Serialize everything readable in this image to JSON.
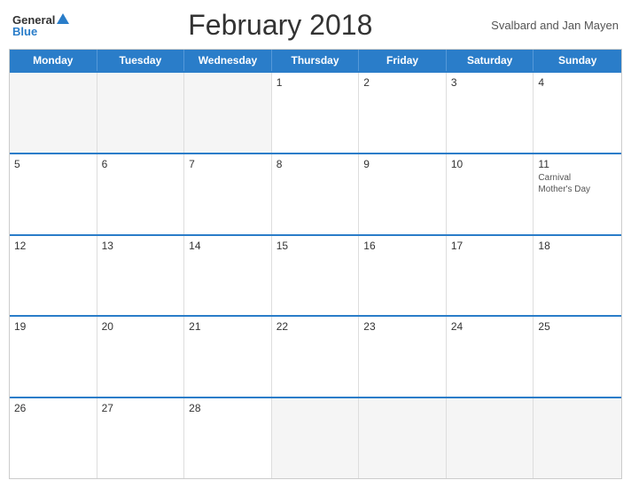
{
  "header": {
    "title": "February 2018",
    "region": "Svalbard and Jan Mayen",
    "logo_general": "General",
    "logo_blue": "Blue"
  },
  "day_headers": [
    "Monday",
    "Tuesday",
    "Wednesday",
    "Thursday",
    "Friday",
    "Saturday",
    "Sunday"
  ],
  "weeks": [
    [
      {
        "day": "",
        "empty": true
      },
      {
        "day": "",
        "empty": true
      },
      {
        "day": "",
        "empty": true
      },
      {
        "day": "1",
        "events": []
      },
      {
        "day": "2",
        "events": []
      },
      {
        "day": "3",
        "events": []
      },
      {
        "day": "4",
        "events": []
      }
    ],
    [
      {
        "day": "5",
        "events": []
      },
      {
        "day": "6",
        "events": []
      },
      {
        "day": "7",
        "events": []
      },
      {
        "day": "8",
        "events": []
      },
      {
        "day": "9",
        "events": []
      },
      {
        "day": "10",
        "events": []
      },
      {
        "day": "11",
        "events": [
          "Carnival",
          "Mother's Day"
        ]
      }
    ],
    [
      {
        "day": "12",
        "events": []
      },
      {
        "day": "13",
        "events": []
      },
      {
        "day": "14",
        "events": []
      },
      {
        "day": "15",
        "events": []
      },
      {
        "day": "16",
        "events": []
      },
      {
        "day": "17",
        "events": []
      },
      {
        "day": "18",
        "events": []
      }
    ],
    [
      {
        "day": "19",
        "events": []
      },
      {
        "day": "20",
        "events": []
      },
      {
        "day": "21",
        "events": []
      },
      {
        "day": "22",
        "events": []
      },
      {
        "day": "23",
        "events": []
      },
      {
        "day": "24",
        "events": []
      },
      {
        "day": "25",
        "events": []
      }
    ],
    [
      {
        "day": "26",
        "events": []
      },
      {
        "day": "27",
        "events": []
      },
      {
        "day": "28",
        "events": []
      },
      {
        "day": "",
        "empty": true
      },
      {
        "day": "",
        "empty": true
      },
      {
        "day": "",
        "empty": true
      },
      {
        "day": "",
        "empty": true
      }
    ]
  ],
  "colors": {
    "header_bg": "#2a7dc9",
    "accent": "#2a7dc9"
  }
}
